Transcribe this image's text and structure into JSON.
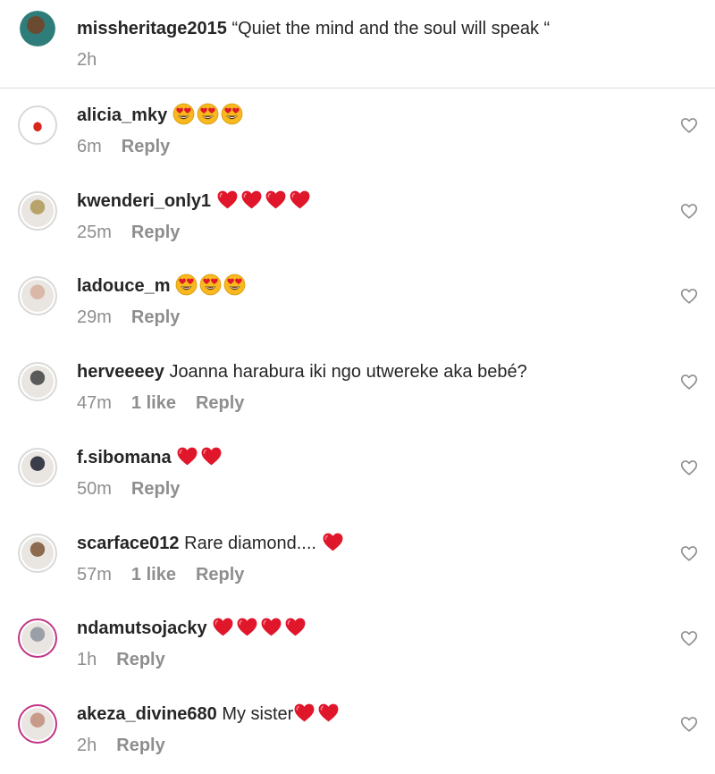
{
  "caption": {
    "username": "missheritage2015",
    "text": "“Quiet the mind and the soul will speak “",
    "time": "2h"
  },
  "comments": [
    {
      "username": "alicia_mky",
      "text": "",
      "emoji": [
        "heart-eyes",
        "heart-eyes",
        "heart-eyes"
      ],
      "time": "6m",
      "likes": "",
      "reply": "Reply",
      "avatar_color": "#c9c2c0"
    },
    {
      "username": "kwenderi_only1",
      "text": "",
      "emoji": [
        "heart",
        "heart",
        "heart",
        "heart"
      ],
      "time": "25m",
      "likes": "",
      "reply": "Reply",
      "avatar_color": "#b8a36a"
    },
    {
      "username": "ladouce_m",
      "text": "",
      "emoji": [
        "heart-eyes",
        "heart-eyes",
        "heart-eyes"
      ],
      "time": "29m",
      "likes": "",
      "reply": "Reply",
      "avatar_color": "#d9b8a8"
    },
    {
      "username": "herveeeey",
      "text": "Joanna harabura iki ngo utwereke aka bebé?",
      "emoji": [],
      "time": "47m",
      "likes": "1 like",
      "reply": "Reply",
      "avatar_color": "#5a5a5a"
    },
    {
      "username": "f.sibomana",
      "text": "",
      "emoji": [
        "heart",
        "heart"
      ],
      "time": "50m",
      "likes": "",
      "reply": "Reply",
      "avatar_color": "#3b3e4a"
    },
    {
      "username": "scarface012",
      "text": "Rare diamond.... ",
      "emoji": [
        "heart"
      ],
      "time": "57m",
      "likes": "1 like",
      "reply": "Reply",
      "avatar_color": "#8c6a4f"
    },
    {
      "username": "ndamutsojacky",
      "text": "",
      "emoji": [
        "heart",
        "heart",
        "heart",
        "heart"
      ],
      "time": "1h",
      "likes": "",
      "reply": "Reply",
      "avatar_color": "#9aa0a6"
    },
    {
      "username": "akeza_divine680",
      "text": "My sister",
      "emoji": [
        "heart",
        "heart"
      ],
      "time": "2h",
      "likes": "",
      "reply": "Reply",
      "avatar_color": "#c89a8a"
    }
  ],
  "colors": {
    "text": "#262626",
    "meta": "#8e8e8e",
    "heart_emoji": "#e0162b",
    "story_ring": "#c13584"
  },
  "icons": {
    "like_button": "heart-outline-icon",
    "heart_emoji": "red-heart-emoji",
    "heart_eyes_emoji": "heart-eyes-emoji"
  }
}
